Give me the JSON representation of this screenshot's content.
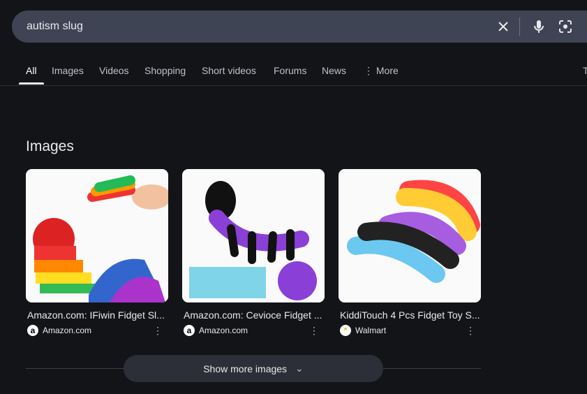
{
  "search": {
    "query": "autism slug"
  },
  "tabs": [
    {
      "label": "All",
      "active": true
    },
    {
      "label": "Images"
    },
    {
      "label": "Videos"
    },
    {
      "label": "Shopping"
    },
    {
      "label": "Short videos"
    },
    {
      "label": "Forums"
    },
    {
      "label": "News"
    },
    {
      "label": "More"
    },
    {
      "label": "T"
    }
  ],
  "images_section": {
    "heading": "Images",
    "results": [
      {
        "title": "Amazon.com: IFiwin Fidget Sl...",
        "source": "Amazon.com",
        "favicon": "a"
      },
      {
        "title": "Amazon.com: Cevioce Fidget ...",
        "source": "Amazon.com",
        "favicon": "a"
      },
      {
        "title": "KiddiTouch 4 Pcs Fidget Toy S...",
        "source": "Walmart",
        "favicon": "*"
      }
    ],
    "show_more_label": "Show more images"
  }
}
